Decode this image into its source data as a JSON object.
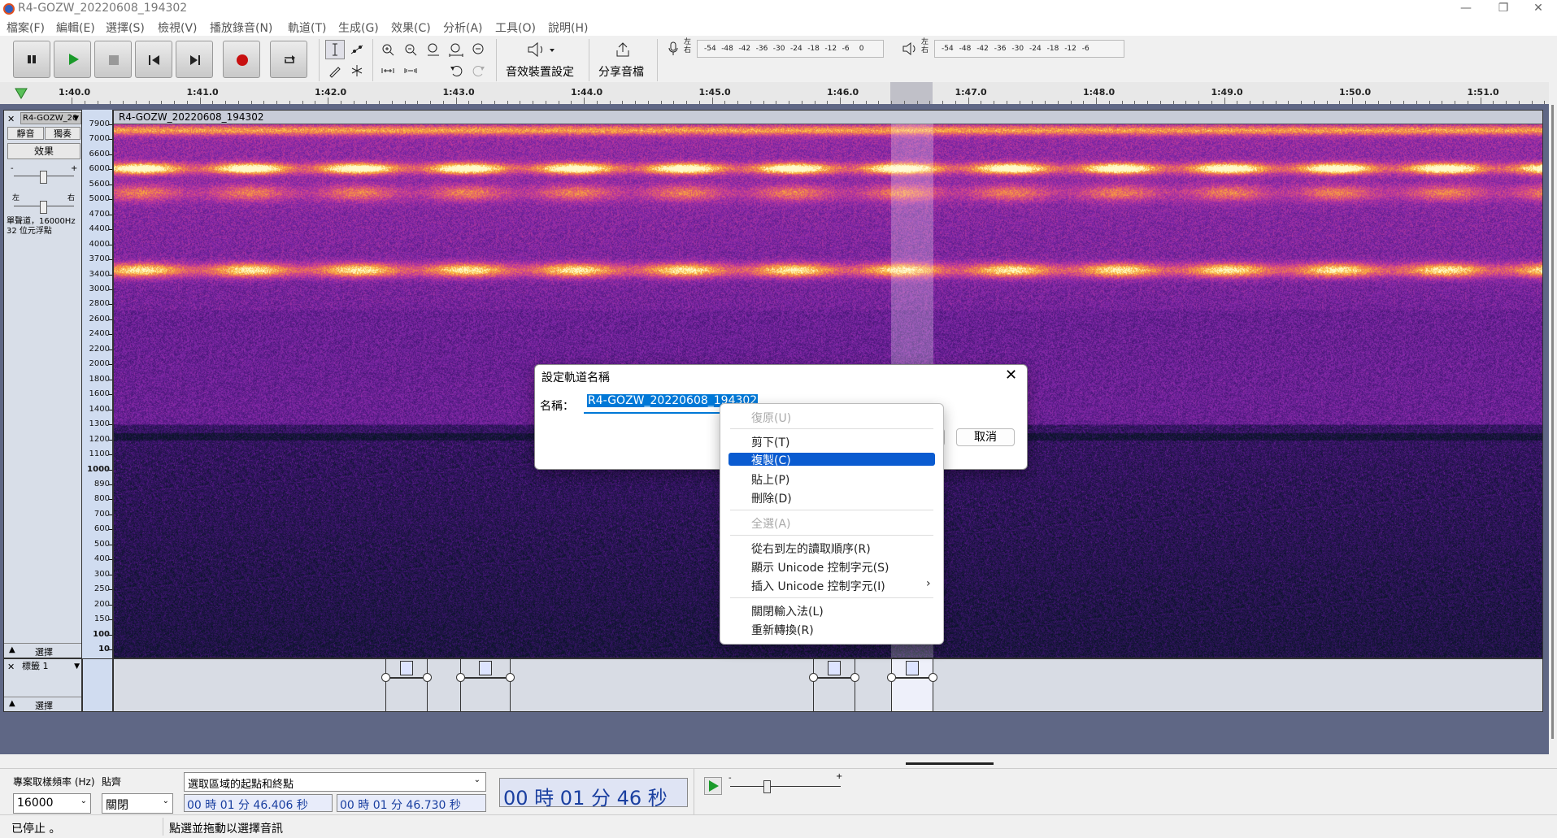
{
  "window": {
    "title": "R4-GOZW_20220608_194302"
  },
  "menubar": {
    "items": [
      "檔案(F)",
      "編輯(E)",
      "選擇(S)",
      "檢視(V)",
      "播放錄音(N)",
      "軌道(T)",
      "生成(G)",
      "效果(C)",
      "分析(A)",
      "工具(O)",
      "說明(H)"
    ]
  },
  "toolbar": {
    "audio_setup_label": "音效裝置設定",
    "share_label": "分享音檔",
    "record_meter": {
      "channels": "左\n右",
      "ticks": [
        "-54",
        "-48",
        "-42",
        "-36",
        "-30",
        "-24",
        "-18",
        "-12",
        "-6",
        "0"
      ]
    },
    "play_meter": {
      "channels": "左\n右",
      "ticks": [
        "-54",
        "-48",
        "-42",
        "-36",
        "-30",
        "-24",
        "-18",
        "-12",
        "-6"
      ]
    }
  },
  "ruler": {
    "labels": [
      "1:40.0",
      "1:41.0",
      "1:42.0",
      "1:43.0",
      "1:44.0",
      "1:45.0",
      "1:46.0",
      "1:47.0",
      "1:48.0",
      "1:49.0",
      "1:50.0",
      "1:51.0"
    ]
  },
  "audio_track": {
    "name_short": "R4-GOZW_20",
    "clip_name": "R4-GOZW_20220608_194302",
    "mute_label": "靜音",
    "solo_label": "獨奏",
    "effects_label": "效果",
    "gain_minus": "-",
    "gain_plus": "+",
    "pan_left": "左",
    "pan_right": "右",
    "info_line1": "單聲道，16000Hz",
    "info_line2": "32 位元浮點",
    "select_label": "選擇",
    "freq_labels": [
      "7900",
      "7000",
      "6600",
      "6000",
      "5600",
      "5000",
      "4700",
      "4400",
      "4000",
      "3700",
      "3400",
      "3000",
      "2800",
      "2600",
      "2400",
      "2200",
      "2000",
      "1800",
      "1600",
      "1400",
      "1300",
      "1200",
      "1100",
      "1000",
      "890",
      "800",
      "700",
      "600",
      "500",
      "400",
      "300",
      "250",
      "200",
      "150",
      "100",
      "10"
    ]
  },
  "label_track": {
    "name": "標籤 1",
    "select_label": "選擇"
  },
  "dialog": {
    "title": "設定軌道名稱",
    "name_label": "名稱：",
    "name_value": "R4-GOZW_20220608_194302",
    "cancel_label": "取消"
  },
  "context_menu": {
    "undo": "復原(U)",
    "cut": "剪下(T)",
    "copy": "複製(C)",
    "paste": "貼上(P)",
    "delete": "刪除(D)",
    "select_all": "全選(A)",
    "rtl": "從右到左的讀取順序(R)",
    "show_unicode": "顯示 Unicode 控制字元(S)",
    "insert_unicode": "插入 Unicode 控制字元(I)",
    "insert_arrow": "›",
    "close_ime": "關閉輸入法(L)",
    "reconvert": "重新轉換(R)"
  },
  "selection_bar": {
    "rate_label": "專案取樣頻率 (Hz)",
    "rate_value": "16000",
    "snap_label": "貼齊",
    "snap_value": "關閉",
    "mode_label": "選取區域的起點和終點",
    "start_time": "00 時 01 分 46.406 秒",
    "end_time": "00 時 01 分 46.730 秒",
    "big_time": "00 時 01 分 46 秒"
  },
  "status": {
    "state": "已停止 。",
    "hint": "點選並拖動以選擇音訊"
  },
  "colors": {
    "accent": "#0078d7",
    "menu_highlight": "#0a5bd0",
    "record": "#c81010",
    "play": "#1a9a2a"
  }
}
